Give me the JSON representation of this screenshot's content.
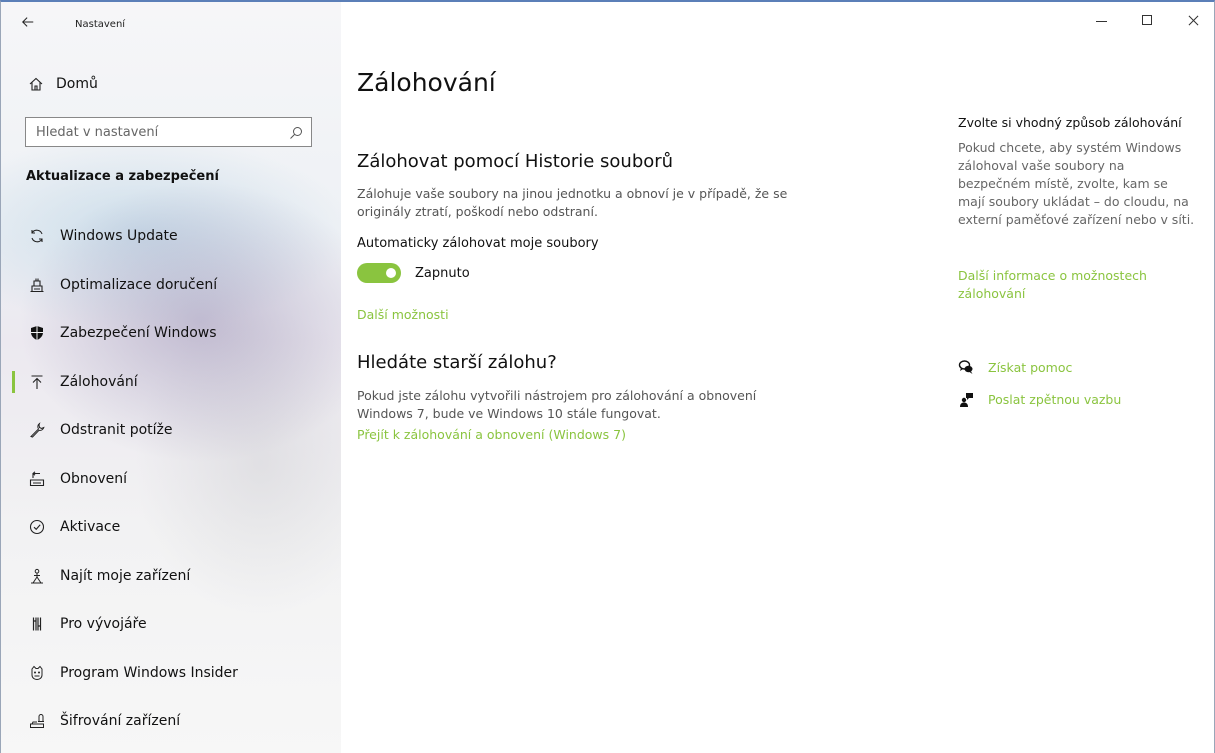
{
  "window": {
    "title": "Nastavení"
  },
  "sidebar": {
    "home_label": "Domů",
    "search_placeholder": "Hledat v nastavení",
    "section_title": "Aktualizace a zabezpečení",
    "items": [
      {
        "label": "Windows Update",
        "icon": "refresh-icon"
      },
      {
        "label": "Optimalizace doručení",
        "icon": "delivery-optimization-icon"
      },
      {
        "label": "Zabezpečení Windows",
        "icon": "shield-icon"
      },
      {
        "label": "Zálohování",
        "icon": "backup-arrow-icon",
        "active": true
      },
      {
        "label": "Odstranit potíže",
        "icon": "wrench-icon"
      },
      {
        "label": "Obnovení",
        "icon": "recovery-icon"
      },
      {
        "label": "Aktivace",
        "icon": "check-circle-icon"
      },
      {
        "label": "Najít moje zařízení",
        "icon": "find-device-icon"
      },
      {
        "label": "Pro vývojáře",
        "icon": "developer-icon"
      },
      {
        "label": "Program Windows Insider",
        "icon": "insider-icon"
      },
      {
        "label": "Šifrování zařízení",
        "icon": "lock-drive-icon"
      }
    ]
  },
  "main": {
    "page_title": "Zálohování",
    "file_history": {
      "heading": "Zálohovat pomocí Historie souborů",
      "description": "Zálohuje vaše soubory na jinou jednotku a obnoví je v případě, že se originály ztratí, poškodí nebo odstraní.",
      "auto_label": "Automaticky zálohovat moje soubory",
      "toggle_state": "Zapnuto",
      "more_options": "Další možnosti"
    },
    "older_backup": {
      "heading": "Hledáte starší zálohu?",
      "description": "Pokud jste zálohu vytvořili nástrojem pro zálohování a obnovení Windows 7, bude ve Windows 10 stále fungovat.",
      "link": "Přejít k zálohování a obnovení (Windows 7)"
    }
  },
  "aside": {
    "title": "Zvolte si vhodný způsob zálohování",
    "description": "Pokud chcete, aby systém Windows zálohoval vaše soubory na bezpečném místě, zvolte, kam se mají soubory ukládat – do cloudu, na externí paměťové zařízení nebo v síti.",
    "more_info_link": "Další informace o možnostech zálohování",
    "get_help": "Získat pomoc",
    "send_feedback": "Poslat zpětnou vazbu"
  },
  "colors": {
    "accent": "#8ac43f",
    "title_border": "#5b7fb8"
  }
}
